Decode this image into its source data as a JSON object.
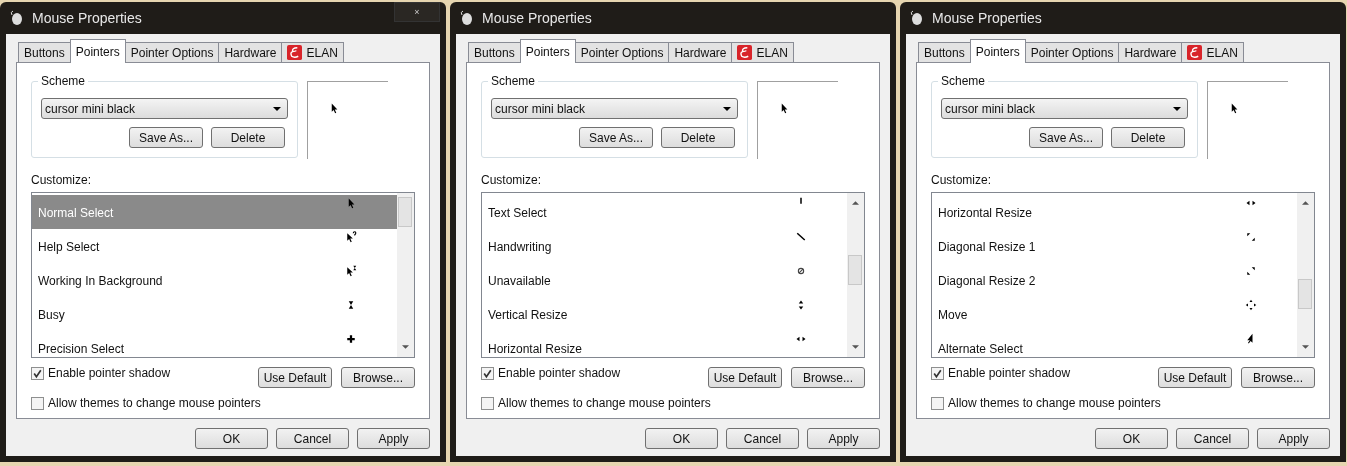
{
  "windows": [
    {
      "title": "Mouse Properties",
      "close_button": "×",
      "tabs": [
        {
          "label": "Buttons",
          "selected": false,
          "kind": "text"
        },
        {
          "label": "Pointers",
          "selected": true,
          "kind": "text"
        },
        {
          "label": "Pointer Options",
          "selected": false,
          "kind": "text"
        },
        {
          "label": "Hardware",
          "selected": false,
          "kind": "text"
        },
        {
          "label": "ELAN",
          "selected": false,
          "kind": "logo"
        }
      ],
      "scheme": {
        "label": "Scheme",
        "value": "cursor mini black",
        "buttons": [
          "Save As...",
          "Delete"
        ]
      },
      "customize_label": "Customize:",
      "rows": [
        {
          "label": "Normal Select",
          "kind": "arrow",
          "selected": true
        },
        {
          "label": "Help Select",
          "kind": "help",
          "selected": false
        },
        {
          "label": "Working In Background",
          "kind": "working",
          "selected": false
        },
        {
          "label": "Busy",
          "kind": "busy",
          "selected": false
        },
        {
          "label": "Precision Select",
          "kind": "crosshair",
          "selected": false
        }
      ],
      "shadow": {
        "label": "Enable pointer shadow",
        "checked": true
      },
      "themes": {
        "label": "Allow themes to change mouse pointers",
        "checked": false
      },
      "list_buttons": [
        "Use Default",
        "Browse..."
      ],
      "dialog_buttons": [
        "OK",
        "Cancel",
        "Apply"
      ]
    },
    {
      "title": "Mouse Properties",
      "tabs": [
        {
          "label": "Buttons",
          "selected": false,
          "kind": "text"
        },
        {
          "label": "Pointers",
          "selected": true,
          "kind": "text"
        },
        {
          "label": "Pointer Options",
          "selected": false,
          "kind": "text"
        },
        {
          "label": "Hardware",
          "selected": false,
          "kind": "text"
        },
        {
          "label": "ELAN",
          "selected": false,
          "kind": "logo"
        }
      ],
      "scheme": {
        "label": "Scheme",
        "value": "cursor mini black",
        "buttons": [
          "Save As...",
          "Delete"
        ]
      },
      "customize_label": "Customize:",
      "rows": [
        {
          "label": "Text Select",
          "kind": "text",
          "selected": false
        },
        {
          "label": "Handwriting",
          "kind": "pen",
          "selected": false
        },
        {
          "label": "Unavailable",
          "kind": "unavailable",
          "selected": false
        },
        {
          "label": "Vertical Resize",
          "kind": "vertical",
          "selected": false
        },
        {
          "label": "Horizontal Resize",
          "kind": "horizontal",
          "selected": false
        }
      ],
      "shadow": {
        "label": "Enable pointer shadow",
        "checked": true
      },
      "themes": {
        "label": "Allow themes to change mouse pointers",
        "checked": false
      },
      "list_buttons": [
        "Use Default",
        "Browse..."
      ],
      "dialog_buttons": [
        "OK",
        "Cancel",
        "Apply"
      ]
    },
    {
      "title": "Mouse Properties",
      "tabs": [
        {
          "label": "Buttons",
          "selected": false,
          "kind": "text"
        },
        {
          "label": "Pointers",
          "selected": true,
          "kind": "text"
        },
        {
          "label": "Pointer Options",
          "selected": false,
          "kind": "text"
        },
        {
          "label": "Hardware",
          "selected": false,
          "kind": "text"
        },
        {
          "label": "ELAN",
          "selected": false,
          "kind": "logo"
        }
      ],
      "scheme": {
        "label": "Scheme",
        "value": "cursor mini black",
        "buttons": [
          "Save As...",
          "Delete"
        ]
      },
      "customize_label": "Customize:",
      "rows": [
        {
          "label": "Horizontal Resize",
          "kind": "horizontal",
          "selected": false
        },
        {
          "label": "Diagonal Resize 1",
          "kind": "diagonal1",
          "selected": false
        },
        {
          "label": "Diagonal Resize 2",
          "kind": "diagonal2",
          "selected": false
        },
        {
          "label": "Move",
          "kind": "move",
          "selected": false
        },
        {
          "label": "Alternate Select",
          "kind": "alternate",
          "selected": false
        }
      ],
      "shadow": {
        "label": "Enable pointer shadow",
        "checked": true
      },
      "themes": {
        "label": "Allow themes to change mouse pointers",
        "checked": false
      },
      "list_buttons": [
        "Use Default",
        "Browse..."
      ],
      "dialog_buttons": [
        "OK",
        "Cancel",
        "Apply"
      ]
    }
  ]
}
